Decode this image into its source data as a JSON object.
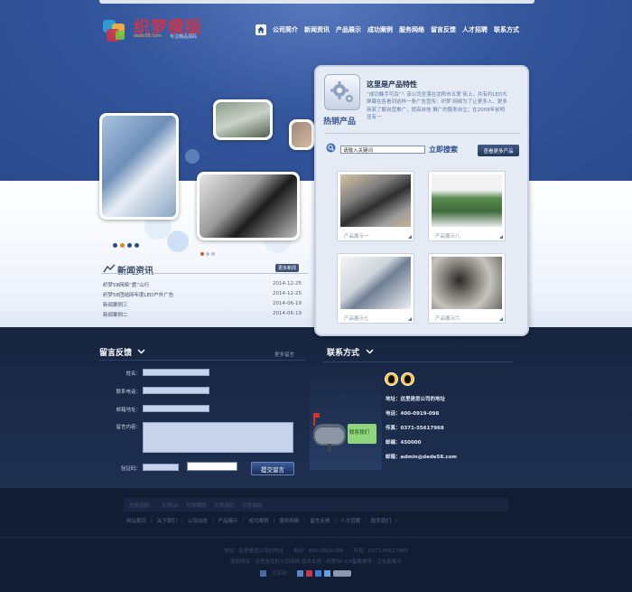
{
  "brand": {
    "name": "织梦模版",
    "domain": "dede58.com",
    "tagline": "专注精品源码"
  },
  "nav": {
    "items": [
      "公司简介",
      "新闻资讯",
      "产品展示",
      "成功案例",
      "服务网络",
      "留言反馈",
      "人才招聘",
      "联系方式"
    ]
  },
  "news": {
    "title": "新闻资讯",
    "more": "更多新闻",
    "items": [
      {
        "title": "织梦58网络“震”山行",
        "date": "2014-12-25"
      },
      {
        "title": "织梦58团结网年度LED户外广告",
        "date": "2014-12-25"
      },
      {
        "title": "新闻案例三",
        "date": "2014-06-19"
      },
      {
        "title": "新闻案例二",
        "date": "2014-06-19"
      }
    ]
  },
  "products": {
    "section_label": "热销产品",
    "intro_title": "这里是产品特性",
    "intro_text": "“成功触手可及”！该公司坐落在沈阳市五爱 街上，共有约LED大屏幕在各看到这样一条广告宣传：织梦 网络为了让更多人，更多商家了解自营推广，提高自信 推广的服务自立；在2008年前明显有一",
    "search_placeholder": "请输入关键词",
    "search_button": "立即搜索",
    "more_button": "查看更多产品",
    "items": [
      {
        "caption": "产品展示一"
      },
      {
        "caption": "产品展示八"
      },
      {
        "caption": "产品展示七"
      },
      {
        "caption": "产品展示六"
      }
    ]
  },
  "feedback": {
    "title": "留言反馈",
    "more": "更多留言",
    "fields": {
      "name": "姓名：",
      "phone": "联系电话：",
      "email": "邮箱地址：",
      "content": "留言内容：",
      "captcha": "验证码："
    },
    "submit": "提交留言"
  },
  "contact": {
    "title": "联系方式",
    "sign": "联系我们",
    "address": "地址：这里是您公司的地址",
    "phone": "电话：400-0919-098",
    "fax": "传真：0371-55617968",
    "zip": "邮编：450000",
    "email": "邮箱：admin@dede58.com"
  },
  "footer": {
    "links_label": "友情链接：",
    "links": [
      "织梦58",
      "织梦模版",
      "织梦源码",
      "织梦模板"
    ],
    "nav": [
      "网站首页",
      "关于我们",
      "公司动态",
      "产品展示",
      "成功案例",
      "服务网络",
      "留言反馈",
      "人才招聘",
      "联系我们"
    ],
    "line1": "地址：这里是您公司的地址　　电话：400-0919-098　　传真：0371-55617968",
    "line2": "版权所有：这里是您的公司名称  技术支持：织梦58 ICP备案编号：正在备案中",
    "share_label": "分享到："
  },
  "colors": {
    "header_blue": "#34569d",
    "panel_bg": "#e4ebf5",
    "dark_bg": "#1b2b4a",
    "logo_red": "#c9364b",
    "accent_orange": "#e08a1b"
  }
}
